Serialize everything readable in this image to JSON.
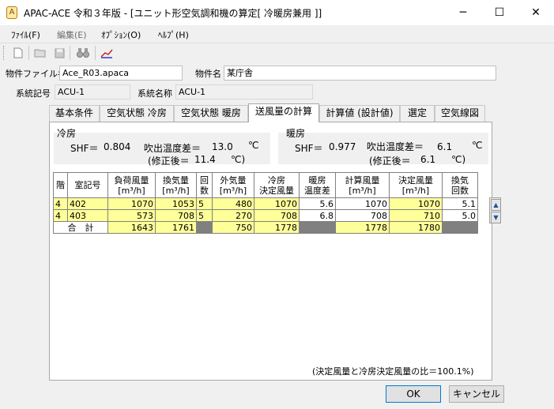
{
  "window": {
    "title": "APAC-ACE 令和３年版 - [ユニット形空気調和機の算定[ 冷暖房兼用 ]]",
    "minimize": "─",
    "maximize": "☐",
    "close": "✕"
  },
  "menu": {
    "file": "ﾌｧｲﾙ(F)",
    "edit": "編集(E)",
    "options": "ｵﾌﾟｼｮﾝ(O)",
    "help": "ﾍﾙﾌﾟ(H)"
  },
  "toolbar_icons": [
    "new-file-icon",
    "open-folder-icon",
    "save-icon",
    "binoculars-icon",
    "chart-icon"
  ],
  "file_row": {
    "file_label": "物件ファイル名",
    "file_value": "Ace_R03.apaca",
    "name_label": "物件名",
    "name_value": "某庁舎"
  },
  "system_row": {
    "code_label": "系統記号",
    "code_value": "ACU-1",
    "name_label": "系統名称",
    "name_value": "ACU-1"
  },
  "tabs": [
    "基本条件",
    "空気状態 冷房",
    "空気状態 暖房",
    "送風量の計算",
    "計算値 (設計値)",
    "選定",
    "空気線図"
  ],
  "active_tab": 3,
  "cooling": {
    "title": "冷房",
    "shf_label": "SHF＝",
    "shf_value": "0.804",
    "dt_label": "吹出温度差＝",
    "dt_value": "13.0",
    "unit": "℃",
    "corrected_label": "(修正後＝",
    "corrected_value": "11.4",
    "corrected_unit": "℃)"
  },
  "heating": {
    "title": "暖房",
    "shf_label": "SHF＝",
    "shf_value": "0.977",
    "dt_label": "吹出温度差＝",
    "dt_value": "6.1",
    "unit": "℃",
    "corrected_label": "(修正後＝",
    "corrected_value": "6.1",
    "corrected_unit": "℃)"
  },
  "table": {
    "headers": [
      [
        "階",
        ""
      ],
      [
        "室記号",
        ""
      ],
      [
        "負荷風量",
        "[m³/h]"
      ],
      [
        "換気量",
        "[m³/h]"
      ],
      [
        "回",
        "数"
      ],
      [
        "外気量",
        "[m³/h]"
      ],
      [
        "冷房",
        "決定風量"
      ],
      [
        "暖房",
        "温度差"
      ],
      [
        "計算風量",
        "[m³/h]"
      ],
      [
        "決定風量",
        "[m³/h]"
      ],
      [
        "換気",
        "回数"
      ]
    ],
    "rows": [
      [
        "4",
        "402",
        "1070",
        "1053",
        "5",
        "480",
        "1070",
        "5.6",
        "1070",
        "1070",
        "5.1"
      ],
      [
        "4",
        "403",
        "573",
        "708",
        "5",
        "270",
        "708",
        "6.8",
        "708",
        "710",
        "5.0"
      ]
    ],
    "total": {
      "label": "合　計",
      "load_airflow": "1643",
      "ventilation": "1761",
      "outdoor_air": "750",
      "cooling_decided": "1778",
      "calc_airflow": "1778",
      "decided_airflow": "1780"
    }
  },
  "ratio_text": "(決定風量と冷房決定風量の比＝100.1%)",
  "buttons": {
    "ok": "OK",
    "cancel": "キャンセル"
  }
}
